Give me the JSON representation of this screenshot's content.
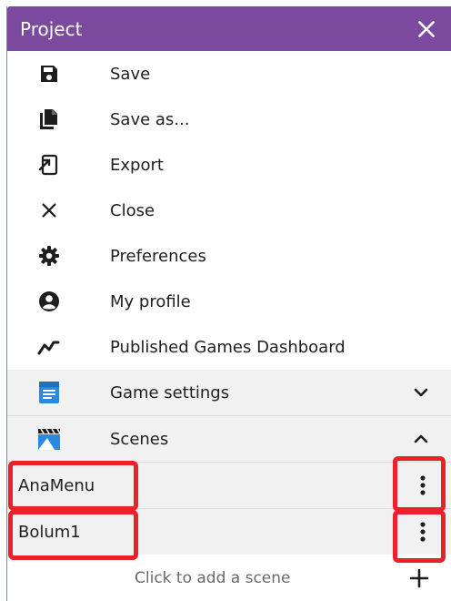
{
  "panel": {
    "title": "Project"
  },
  "menu": {
    "items": [
      {
        "label": "Save",
        "icon": "save-icon"
      },
      {
        "label": "Save as...",
        "icon": "save-as-icon"
      },
      {
        "label": "Export",
        "icon": "export-icon"
      },
      {
        "label": "Close",
        "icon": "close-icon"
      },
      {
        "label": "Preferences",
        "icon": "gear-icon"
      },
      {
        "label": "My profile",
        "icon": "profile-icon"
      },
      {
        "label": "Published Games Dashboard",
        "icon": "chart-line-icon"
      }
    ]
  },
  "sections": {
    "game_settings": {
      "label": "Game settings",
      "icon": "document-icon",
      "state": "collapsed"
    },
    "scenes": {
      "label": "Scenes",
      "icon": "clapperboard-icon",
      "state": "expanded"
    }
  },
  "scenes": {
    "items": [
      {
        "name": "AnaMenu"
      },
      {
        "name": "Bolum1"
      }
    ],
    "add_label": "Click to add a scene"
  },
  "colors": {
    "titlebar": "#7b4a9e",
    "highlight": "#e8212b",
    "section_bg": "#f1f1f1",
    "accent_border": "#43b18f"
  }
}
